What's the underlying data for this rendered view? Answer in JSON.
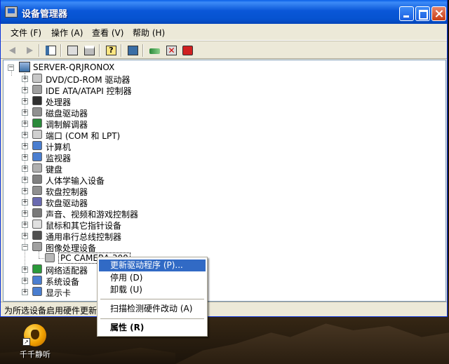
{
  "window": {
    "title": "设备管理器"
  },
  "menu": {
    "items": [
      "文件 (F)",
      "操作 (A)",
      "查看 (V)",
      "帮助 (H)"
    ]
  },
  "tree": {
    "root": "SERVER-QRJRONOX",
    "items": [
      {
        "label": "DVD/CD-ROM 驱动器",
        "icon": "cdrom-icon"
      },
      {
        "label": "IDE ATA/ATAPI 控制器",
        "icon": "ide-controller-icon"
      },
      {
        "label": "处理器",
        "icon": "processor-icon"
      },
      {
        "label": "磁盘驱动器",
        "icon": "disk-drive-icon"
      },
      {
        "label": "调制解调器",
        "icon": "modem-icon"
      },
      {
        "label": "端口 (COM 和 LPT)",
        "icon": "port-icon"
      },
      {
        "label": "计算机",
        "icon": "computer-icon"
      },
      {
        "label": "监视器",
        "icon": "monitor-icon"
      },
      {
        "label": "键盘",
        "icon": "keyboard-icon"
      },
      {
        "label": "人体学输入设备",
        "icon": "hid-icon"
      },
      {
        "label": "软盘控制器",
        "icon": "floppy-controller-icon"
      },
      {
        "label": "软盘驱动器",
        "icon": "floppy-drive-icon"
      },
      {
        "label": "声音、视频和游戏控制器",
        "icon": "sound-icon"
      },
      {
        "label": "鼠标和其它指针设备",
        "icon": "mouse-icon"
      },
      {
        "label": "通用串行总线控制器",
        "icon": "usb-icon"
      },
      {
        "label": "图像处理设备",
        "icon": "imaging-device-icon",
        "expanded": true
      },
      {
        "label": "PC CAMERA 300",
        "icon": "camera-icon",
        "child": true,
        "selected": true
      },
      {
        "label": "网络适配器",
        "icon": "network-adapter-icon"
      },
      {
        "label": "系统设备",
        "icon": "system-device-icon"
      },
      {
        "label": "显示卡",
        "icon": "display-adapter-icon"
      }
    ]
  },
  "status": "为所选设备启用硬件更新",
  "context_menu": {
    "items": [
      {
        "label": "更新驱动程序 (P)...",
        "highlighted": true
      },
      {
        "label": "停用 (D)"
      },
      {
        "label": "卸载 (U)"
      },
      {
        "label": "扫描检测硬件改动 (A)"
      },
      {
        "label": "属性 (R)",
        "bold": true
      }
    ]
  },
  "desktop": {
    "icon_label": "千千静听"
  }
}
